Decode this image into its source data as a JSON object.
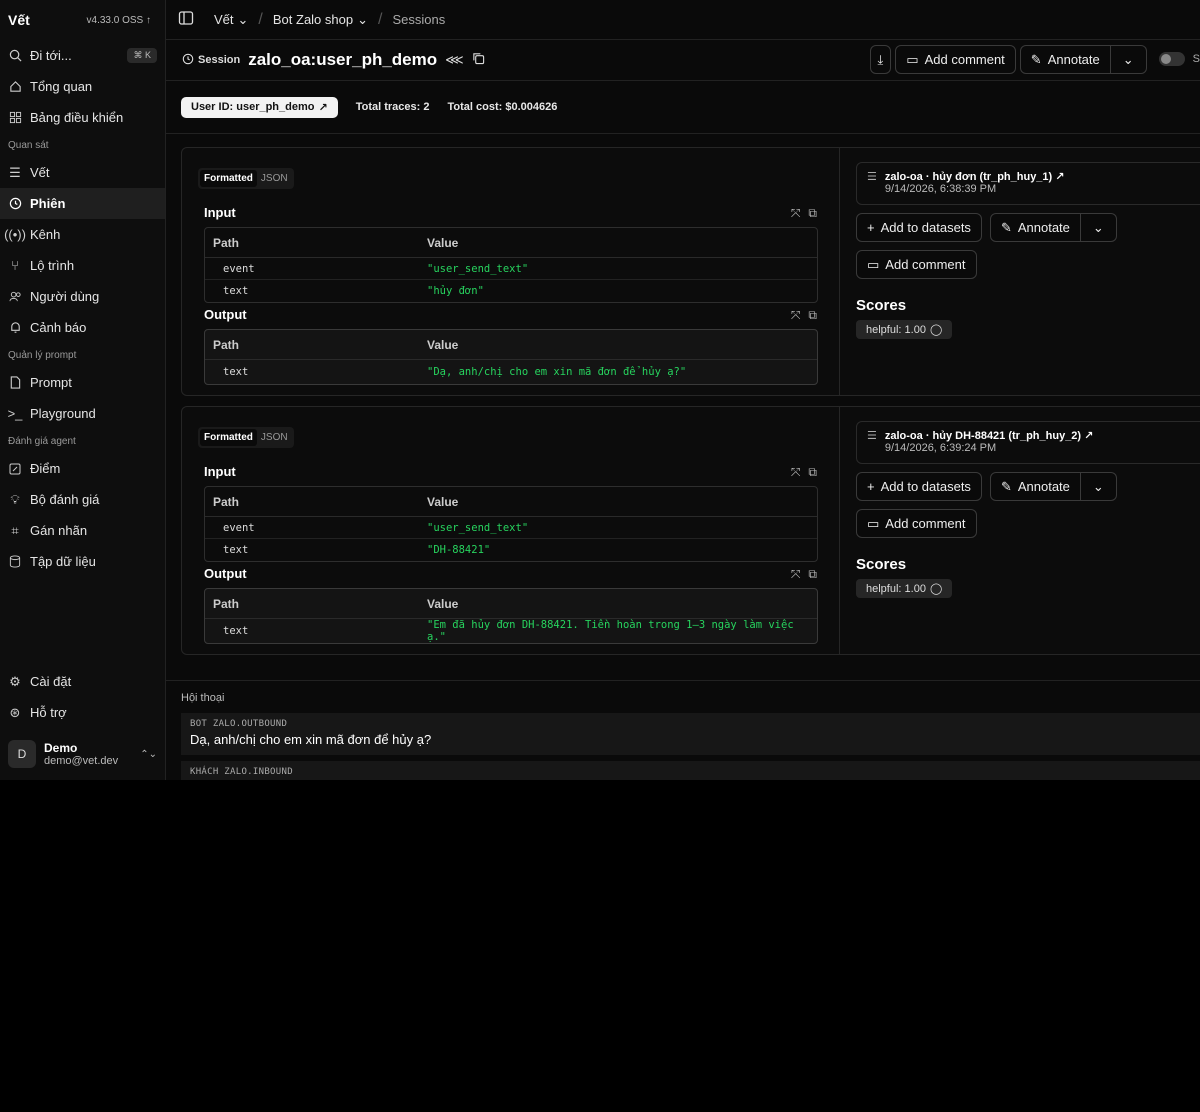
{
  "sidebar": {
    "brand": "Vết",
    "version": "v4.33.0 OSS",
    "goto": {
      "label": "Đi tới...",
      "shortcut": "⌘ K"
    },
    "top_items": [
      {
        "label": "Tổng quan",
        "icon": "home-icon"
      },
      {
        "label": "Bảng điều khiển",
        "icon": "dashboard-icon"
      }
    ],
    "sections": [
      {
        "title": "Quan sát",
        "items": [
          {
            "label": "Vết",
            "icon": "list-tree-icon",
            "active": false
          },
          {
            "label": "Phiên",
            "icon": "clock-icon",
            "active": true
          },
          {
            "label": "Kênh",
            "icon": "radio-icon",
            "active": false
          },
          {
            "label": "Lộ trình",
            "icon": "route-icon",
            "active": false
          },
          {
            "label": "Người dùng",
            "icon": "users-icon",
            "active": false
          },
          {
            "label": "Cảnh báo",
            "icon": "bell-icon",
            "active": false
          }
        ]
      },
      {
        "title": "Quản lý prompt",
        "items": [
          {
            "label": "Prompt",
            "icon": "file-icon"
          },
          {
            "label": "Playground",
            "icon": "terminal-icon"
          }
        ]
      },
      {
        "title": "Đánh giá agent",
        "items": [
          {
            "label": "Điểm",
            "icon": "score-icon"
          },
          {
            "label": "Bộ đánh giá",
            "icon": "lightbulb-icon"
          },
          {
            "label": "Gán nhãn",
            "icon": "tag-icon"
          },
          {
            "label": "Tập dữ liệu",
            "icon": "database-icon"
          }
        ]
      }
    ],
    "bottom_items": [
      {
        "label": "Cài đặt",
        "icon": "gear-icon"
      },
      {
        "label": "Hỗ trợ",
        "icon": "lifebuoy-icon"
      }
    ],
    "user": {
      "initial": "D",
      "name": "Demo",
      "email": "demo@vet.dev"
    }
  },
  "topbar": {
    "crumbs": [
      "Vết",
      "Bot Zalo shop",
      "Sessions"
    ]
  },
  "session": {
    "kicker": "Session",
    "title": "zalo_oa:user_ph_demo",
    "add_comment": "Add comment",
    "annotate": "Annotate",
    "toggle_label": "S"
  },
  "meta": {
    "user_id": "User ID: user_ph_demo",
    "total_traces": "Total traces: 2",
    "total_cost": "Total cost: $0.004626"
  },
  "labels": {
    "formatted": "Formatted",
    "json": "JSON",
    "input": "Input",
    "output": "Output",
    "path": "Path",
    "value": "Value",
    "add_to_datasets": "Add to datasets",
    "annotate": "Annotate",
    "add_comment": "Add comment",
    "scores": "Scores"
  },
  "traces": [
    {
      "name": "zalo-oa · hủy đơn (tr_ph_huy_1) ↗",
      "time": "9/14/2026, 6:38:39 PM",
      "input": [
        {
          "path": "event",
          "value": "\"user_send_text\""
        },
        {
          "path": "text",
          "value": "\"hủy đơn\""
        }
      ],
      "output": [
        {
          "path": "text",
          "value": "\"Dạ, anh/chị cho em xin mã đơn để hủy ạ?\""
        }
      ],
      "score": "helpful: 1.00"
    },
    {
      "name": "zalo-oa · hủy DH-88421 (tr_ph_huy_2) ↗",
      "time": "9/14/2026, 6:39:24 PM",
      "input": [
        {
          "path": "event",
          "value": "\"user_send_text\""
        },
        {
          "path": "text",
          "value": "\"DH-88421\""
        }
      ],
      "output": [
        {
          "path": "text",
          "value": "\"Em đã hủy đơn DH-88421. Tiền hoàn trong 1–3 ngày làm việc ạ.\""
        }
      ],
      "score": "helpful: 1.00"
    }
  ],
  "conversation": {
    "label": "Hội thoại",
    "messages": [
      {
        "meta": "BOT  ZALO.OUTBOUND",
        "text": "Dạ, anh/chị cho em xin mã đơn để hủy ạ?"
      },
      {
        "meta": "KHÁCH  ZALO.INBOUND",
        "text": ""
      }
    ]
  }
}
